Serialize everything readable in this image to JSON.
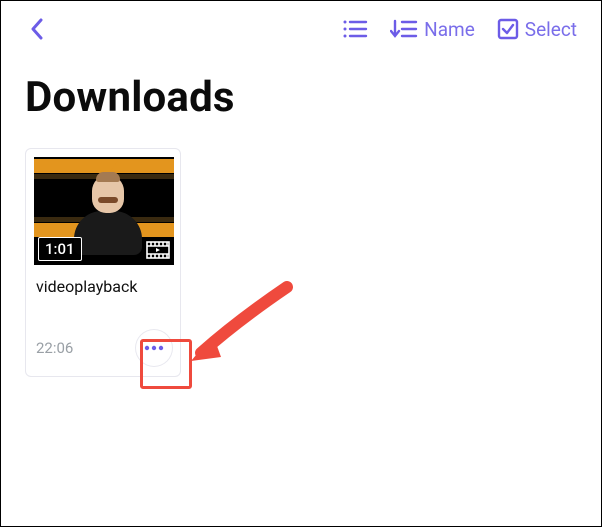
{
  "topbar": {
    "sort_label": "Name",
    "select_label": "Select"
  },
  "page": {
    "title": "Downloads"
  },
  "files": [
    {
      "name": "videoplayback",
      "duration": "1:01",
      "time": "22:06"
    }
  ],
  "icons": {
    "back": "chevron-left-icon",
    "view": "list-view-icon",
    "sort": "sort-down-icon",
    "select": "checkbox-icon",
    "film": "film-play-icon",
    "more": "more-horizontal-icon"
  },
  "annotation": {
    "type": "arrow-pointing-to-more-button"
  }
}
